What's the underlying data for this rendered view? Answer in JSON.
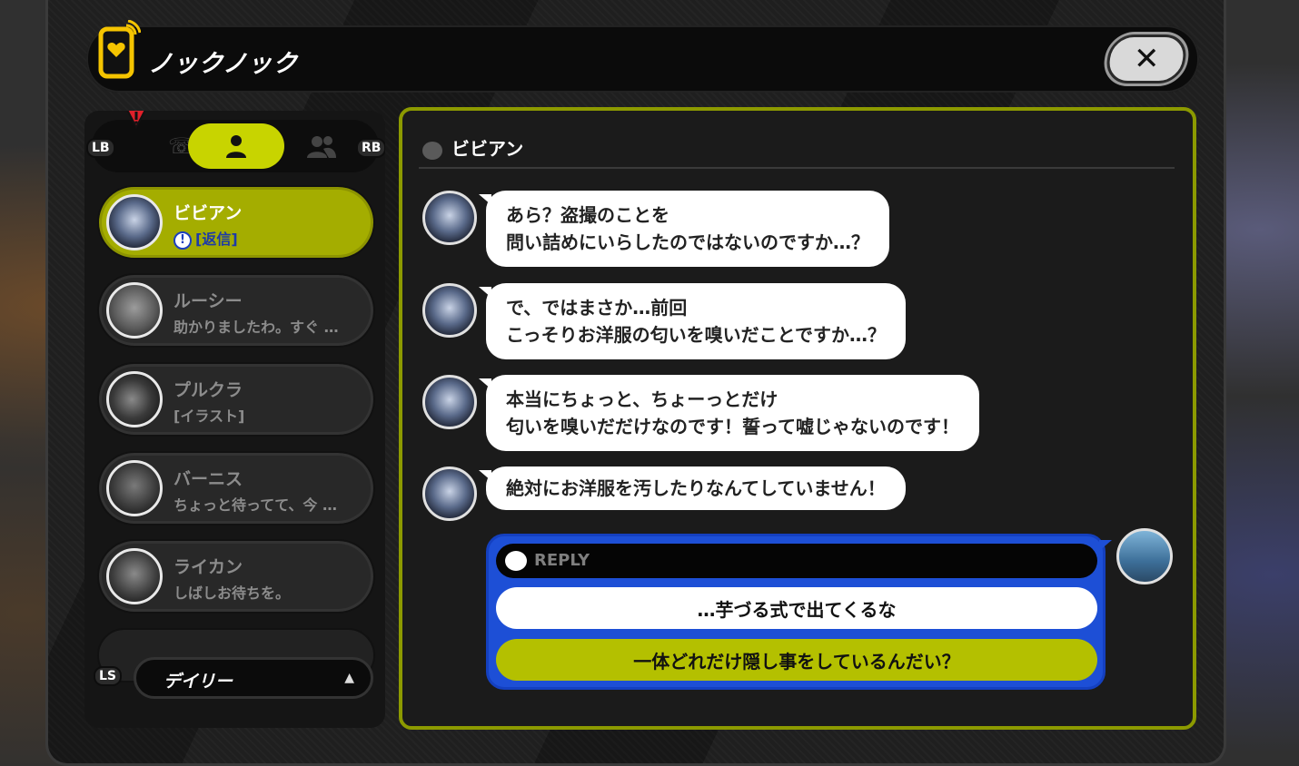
{
  "app": {
    "title": "ノックノック"
  },
  "tabs": {
    "lb": "LB",
    "rb": "RB",
    "ls": "LS"
  },
  "contacts": [
    {
      "name": "ビビアン",
      "preview": "[返信]",
      "active": true
    },
    {
      "name": "ルーシー",
      "preview": "助かりましたわ。すぐ …",
      "active": false
    },
    {
      "name": "プルクラ",
      "preview": "[イラスト]",
      "active": false
    },
    {
      "name": "バーニス",
      "preview": "ちょっと待ってて、今 …",
      "active": false
    },
    {
      "name": "ライカン",
      "preview": "しばしお待ちを。",
      "active": false
    }
  ],
  "filter": {
    "label": "デイリー"
  },
  "chat": {
    "partner": "ビビアン",
    "messages": [
      {
        "line1": "あら？盗撮のことを",
        "line2": "問い詰めにいらしたのではないのですか…？"
      },
      {
        "line1": "で、ではまさか…前回",
        "line2": "こっそりお洋服の匂いを嗅いだことですか…？"
      },
      {
        "line1": "本当にちょっと、ちょーっとだけ",
        "line2": "匂いを嗅いだだけなのです！誓って嘘じゃないのです！"
      },
      {
        "line1": "絶対にお洋服を汚したりなんてしていません！",
        "line2": ""
      }
    ],
    "reply": {
      "label": "REPLY",
      "options": [
        "…芋づる式で出てくるな",
        "一体どれだけ隠し事をしているんだい？"
      ]
    }
  },
  "colors": {
    "accent": "#c8d400",
    "reply_blue": "#1d4fd6",
    "panel_border": "#8c9a00"
  }
}
